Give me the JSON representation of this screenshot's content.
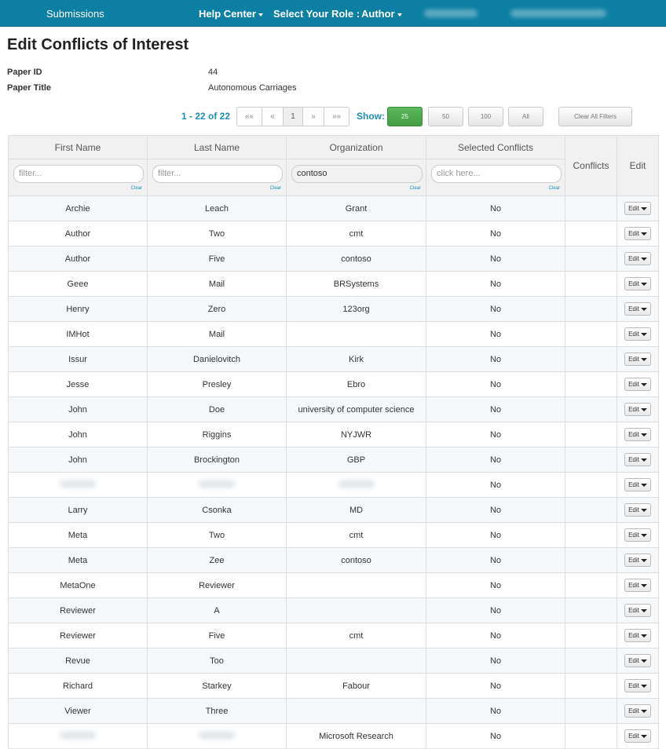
{
  "nav": {
    "submissions": "Submissions",
    "help_center": "Help Center",
    "select_role": "Select Your Role :",
    "role": "Author"
  },
  "page": {
    "title": "Edit Conflicts of Interest",
    "paper_id_label": "Paper ID",
    "paper_id": "44",
    "paper_title_label": "Paper Title",
    "paper_title": "Autonomous Carriages"
  },
  "pager": {
    "count": "1 - 22 of 22",
    "first": "««",
    "prev": "«",
    "page": "1",
    "next": "»",
    "last": "»»",
    "show_label": "Show:",
    "sizes": [
      "25",
      "50",
      "100",
      "All"
    ],
    "active_size": "25",
    "clear_filters": "Clear All Filters"
  },
  "table": {
    "headers": {
      "first_name": "First Name",
      "last_name": "Last Name",
      "organization": "Organization",
      "selected_conflicts": "Selected Conflicts",
      "conflicts": "Conflicts",
      "edit": "Edit"
    },
    "filters": {
      "first_name_placeholder": "filter...",
      "last_name_placeholder": "filter...",
      "organization_value": "contoso",
      "selected_conflicts_placeholder": "click here...",
      "clear_label": "Clear"
    },
    "edit_label": "Edit",
    "rows": [
      {
        "first": "Archie",
        "last": "Leach",
        "org": "Grant",
        "selected": "No"
      },
      {
        "first": "Author",
        "last": "Two",
        "org": "cmt",
        "selected": "No"
      },
      {
        "first": "Author",
        "last": "Five",
        "org": "contoso",
        "selected": "No"
      },
      {
        "first": "Geee",
        "last": "Mail",
        "org": "BRSystems",
        "selected": "No"
      },
      {
        "first": "Henry",
        "last": "Zero",
        "org": "123org",
        "selected": "No"
      },
      {
        "first": "IMHot",
        "last": "Mail",
        "org": "",
        "selected": "No"
      },
      {
        "first": "Issur",
        "last": "Danielovitch",
        "org": "Kirk",
        "selected": "No"
      },
      {
        "first": "Jesse",
        "last": "Presley",
        "org": "Ebro",
        "selected": "No"
      },
      {
        "first": "John",
        "last": "Doe",
        "org": "university of computer science",
        "selected": "No"
      },
      {
        "first": "John",
        "last": "Riggins",
        "org": "NYJWR",
        "selected": "No"
      },
      {
        "first": "John",
        "last": "Brockington",
        "org": "GBP",
        "selected": "No"
      },
      {
        "first": "",
        "last": "",
        "org": "",
        "selected": "No",
        "blurred": true
      },
      {
        "first": "Larry",
        "last": "Csonka",
        "org": "MD",
        "selected": "No"
      },
      {
        "first": "Meta",
        "last": "Two",
        "org": "cmt",
        "selected": "No"
      },
      {
        "first": "Meta",
        "last": "Zee",
        "org": "contoso",
        "selected": "No"
      },
      {
        "first": "MetaOne",
        "last": "Reviewer",
        "org": "",
        "selected": "No"
      },
      {
        "first": "Reviewer",
        "last": "A",
        "org": "",
        "selected": "No"
      },
      {
        "first": "Reviewer",
        "last": "Five",
        "org": "cmt",
        "selected": "No"
      },
      {
        "first": "Revue",
        "last": "Too",
        "org": "",
        "selected": "No"
      },
      {
        "first": "Richard",
        "last": "Starkey",
        "org": "Fabour",
        "selected": "No"
      },
      {
        "first": "Viewer",
        "last": "Three",
        "org": "",
        "selected": "No"
      },
      {
        "first": "",
        "last": "",
        "org": "Microsoft Research",
        "selected": "No",
        "blurred": true
      }
    ]
  }
}
